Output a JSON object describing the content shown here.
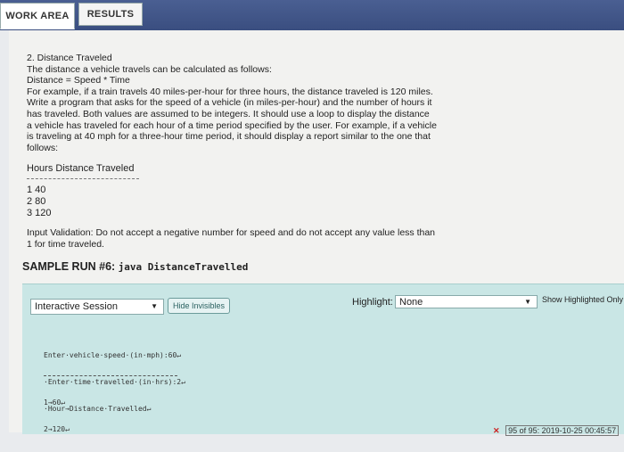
{
  "tabs": {
    "work_area": "WORK AREA",
    "results": "RESULTS"
  },
  "problem": {
    "title": "2. Distance Traveled",
    "line1": "The distance a vehicle travels can be calculated as follows:",
    "line2": "Distance = Speed * Time",
    "para": "For example, if a train travels 40 miles-per-hour for three hours, the distance traveled is 120 miles. Write a program that asks for the speed of a vehicle (in miles-per-hour) and the number of hours it has traveled. Both values are assumed to be integers. It should use a loop to display the distance a vehicle has traveled for each hour of a time period specified by the user. For example, if a vehicle is traveling at 40 mph for a three-hour time period, it should display a report similar to the one that follows:"
  },
  "report": {
    "header": "Hours Distance Traveled",
    "rows": [
      "1 40",
      "2 80",
      "3 120"
    ]
  },
  "validation": "Input Validation: Do not accept a negative number for speed and do not accept any value less than 1 for time traveled.",
  "sample": {
    "label": "SAMPLE RUN #6:",
    "code": "java DistanceTravelled"
  },
  "panel": {
    "session_select": "Interactive Session",
    "hide_invisibles": "Hide Invisibles",
    "highlight_label": "Highlight:",
    "highlight_value": "None",
    "show_highlighted": "Show Highlighted Only",
    "console_lines": [
      "Enter·vehicle·speed·(in·mph):60↵",
      "·Enter·time·travelled·(in·hrs):2↵",
      "·Hour→Distance·Travelled↵",
      "1→60↵",
      "2→120↵"
    ]
  },
  "status": "95 of 95: 2019-10-25 00:45:57"
}
